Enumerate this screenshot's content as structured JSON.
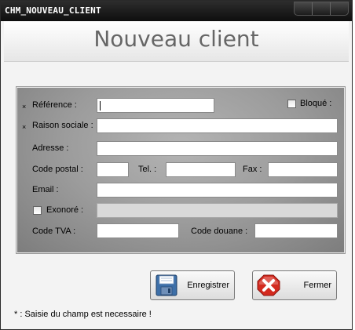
{
  "window": {
    "title": "CHM_NOUVEAU_CLIENT"
  },
  "header": {
    "title": "Nouveau client"
  },
  "form": {
    "required_marker": "×",
    "reference_label": "Référence :",
    "reference_value": "",
    "bloque_label": "Bloqué :",
    "bloque_checked": false,
    "raison_sociale_label": "Raison sociale :",
    "raison_sociale_value": "",
    "adresse_label": "Adresse :",
    "adresse_value": "",
    "code_postal_label": "Code postal :",
    "code_postal_value": "",
    "tel_label": "Tel. :",
    "tel_value": "",
    "fax_label": "Fax :",
    "fax_value": "",
    "email_label": "Email :",
    "email_value": "",
    "exonore_label": "Exonoré :",
    "exonore_checked": false,
    "exonore_value": "",
    "code_tva_label": "Code TVA :",
    "code_tva_value": "",
    "code_douane_label": "Code douane :",
    "code_douane_value": ""
  },
  "buttons": {
    "save_label": "Enregistrer",
    "save_icon": "floppy-disk-icon",
    "close_label": "Fermer",
    "close_icon": "red-x-icon"
  },
  "footnote": "* : Saisie du champ est necessaire !"
}
